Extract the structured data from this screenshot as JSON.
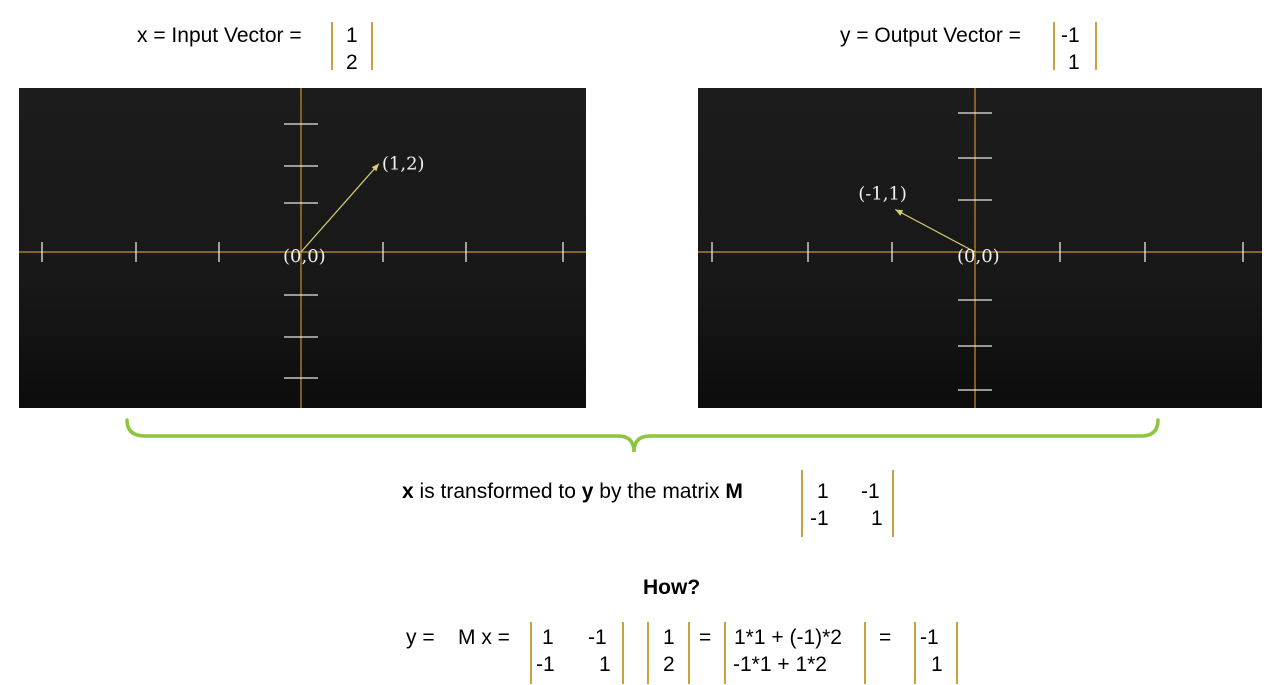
{
  "input": {
    "label": "x = Input Vector =",
    "values": [
      "1",
      "2"
    ]
  },
  "output": {
    "label": "y = Output Vector =",
    "values": [
      "-1",
      "1"
    ]
  },
  "chart_data": [
    {
      "type": "vector-plot",
      "origin_label": "(0,0)",
      "vector": [
        1,
        2
      ],
      "vector_label": "(1,2)",
      "x_ticks_each_side": 3,
      "y_ticks_each_side": 3,
      "axis_color": "#c8902a",
      "vector_color": "#d8d070",
      "background": "#181818"
    },
    {
      "type": "vector-plot",
      "origin_label": "(0,0)",
      "vector": [
        -1,
        1
      ],
      "vector_label": "(-1,1)",
      "x_ticks_each_side": 3,
      "y_ticks_each_side": 3,
      "axis_color": "#c8902a",
      "vector_color": "#d8d070",
      "background": "#181818"
    }
  ],
  "brace_color": "#8cc63f",
  "statement": {
    "x": "x",
    "mid1": " is transformed to ",
    "y": "y",
    "mid2": " by the matrix ",
    "M": "M",
    "matrix": [
      [
        "1",
        "-1"
      ],
      [
        "-1",
        "1"
      ]
    ]
  },
  "how": "How?",
  "equation": {
    "lhs": "y =",
    "mx": "M x =",
    "matrix": [
      [
        "1",
        "-1"
      ],
      [
        "-1",
        "1"
      ]
    ],
    "vector": [
      "1",
      "2"
    ],
    "eq1": "=",
    "expanded": [
      "1*1 + (-1)*2",
      "-1*1 + 1*2"
    ],
    "eq2": "=",
    "result": [
      "-1",
      "1"
    ]
  }
}
